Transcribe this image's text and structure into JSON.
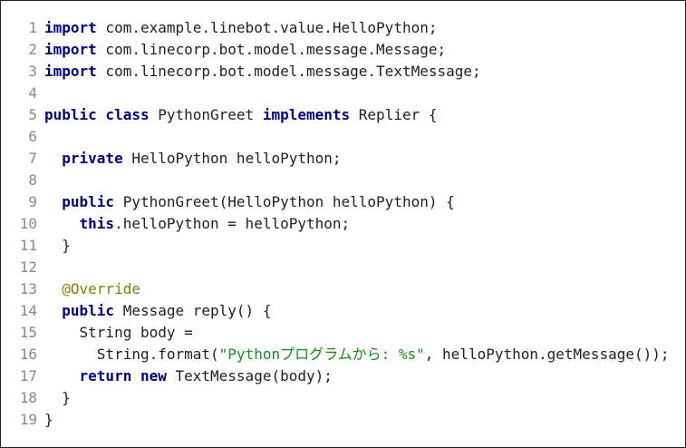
{
  "editor": {
    "lines": [
      {
        "n": "1",
        "parts": [
          [
            "kw",
            "import"
          ],
          [
            "t",
            " com.example.linebot.value.HelloPython;"
          ]
        ]
      },
      {
        "n": "2",
        "parts": [
          [
            "kw",
            "import"
          ],
          [
            "t",
            " com.linecorp.bot.model.message.Message;"
          ]
        ]
      },
      {
        "n": "3",
        "parts": [
          [
            "kw",
            "import"
          ],
          [
            "t",
            " com.linecorp.bot.model.message.TextMessage;"
          ]
        ]
      },
      {
        "n": "4",
        "parts": []
      },
      {
        "n": "5",
        "parts": [
          [
            "kw",
            "public class"
          ],
          [
            "t",
            " PythonGreet "
          ],
          [
            "kw",
            "implements"
          ],
          [
            "t",
            " Replier {"
          ]
        ]
      },
      {
        "n": "6",
        "parts": []
      },
      {
        "n": "7",
        "parts": [
          [
            "t",
            "  "
          ],
          [
            "kw",
            "private"
          ],
          [
            "t",
            " HelloPython helloPython;"
          ]
        ]
      },
      {
        "n": "8",
        "parts": []
      },
      {
        "n": "9",
        "parts": [
          [
            "t",
            "  "
          ],
          [
            "kw",
            "public"
          ],
          [
            "t",
            " PythonGreet(HelloPython helloPython) {"
          ]
        ]
      },
      {
        "n": "10",
        "parts": [
          [
            "t",
            "    "
          ],
          [
            "kw",
            "this"
          ],
          [
            "t",
            ".helloPython = helloPython;"
          ]
        ]
      },
      {
        "n": "11",
        "parts": [
          [
            "t",
            "  }"
          ]
        ]
      },
      {
        "n": "12",
        "parts": []
      },
      {
        "n": "13",
        "parts": [
          [
            "t",
            "  "
          ],
          [
            "ann",
            "@Override"
          ]
        ]
      },
      {
        "n": "14",
        "parts": [
          [
            "t",
            "  "
          ],
          [
            "kw",
            "public"
          ],
          [
            "t",
            " Message reply() {"
          ]
        ]
      },
      {
        "n": "15",
        "parts": [
          [
            "t",
            "    String body ="
          ]
        ]
      },
      {
        "n": "16",
        "parts": [
          [
            "t",
            "      String.format("
          ],
          [
            "str",
            "\"Pythonプログラムから: %s\""
          ],
          [
            "t",
            ", helloPython.getMessage());"
          ]
        ]
      },
      {
        "n": "17",
        "parts": [
          [
            "t",
            "    "
          ],
          [
            "kw",
            "return new"
          ],
          [
            "t",
            " TextMessage(body);"
          ]
        ]
      },
      {
        "n": "18",
        "parts": [
          [
            "t",
            "  }"
          ]
        ]
      },
      {
        "n": "19",
        "parts": [
          [
            "t",
            "}"
          ]
        ]
      }
    ]
  }
}
